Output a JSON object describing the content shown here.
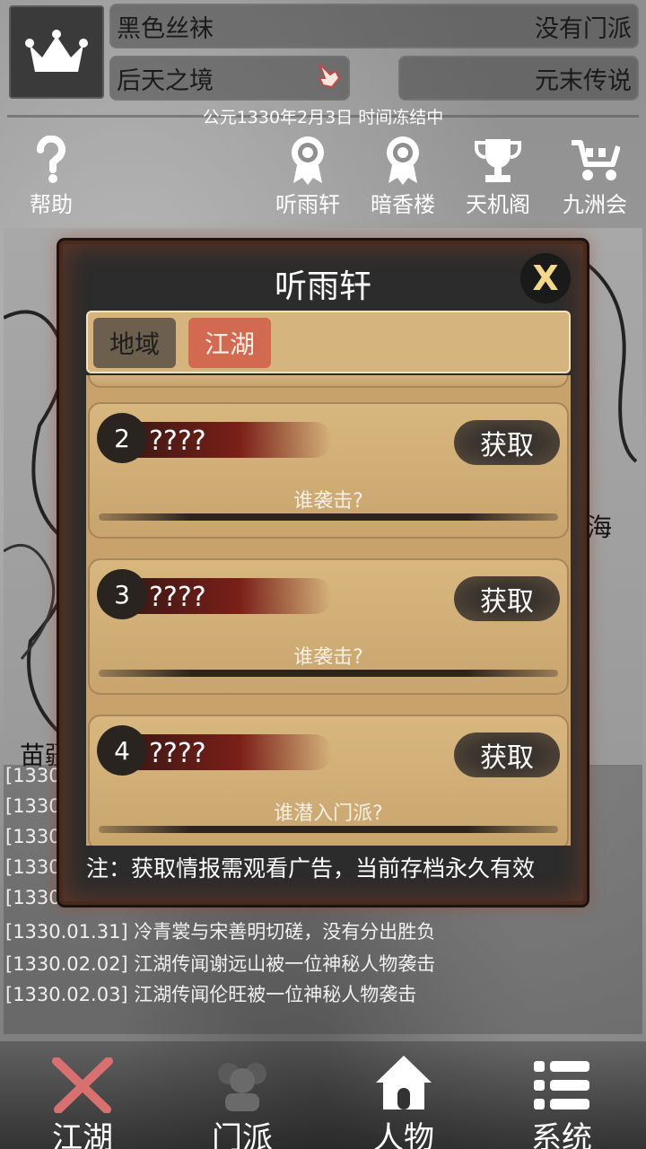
{
  "header": {
    "player_name": "黑色丝袜",
    "sect": "没有门派",
    "realm": "后天之境",
    "title": "元末传说",
    "date_status": "公元1330年2月3日 时间冻结中"
  },
  "top_icons": [
    {
      "label": "帮助",
      "icon": "question-icon"
    },
    {
      "label": "听雨轩",
      "icon": "badge-icon"
    },
    {
      "label": "暗香楼",
      "icon": "badge-icon"
    },
    {
      "label": "天机阁",
      "icon": "trophy-icon"
    },
    {
      "label": "九洲会",
      "icon": "cart-icon"
    }
  ],
  "map_labels": {
    "left": "苗疆",
    "right": "海"
  },
  "log": [
    "[1330.",
    "[1330.",
    "[1330",
    "[1330.",
    "[1330.0",
    "[1330.01.31] 冷青裳与宋善明切磋，没有分出胜负",
    "[1330.02.02] 江湖传闻谢远山被一位神秘人物袭击",
    "[1330.02.03] 江湖传闻伦旺被一位神秘人物袭击"
  ],
  "modal": {
    "title": "听雨轩",
    "close_label": "X",
    "tabs": [
      "地域",
      "江湖"
    ],
    "items": [
      {
        "num": "2",
        "title": "????",
        "button": "获取",
        "question": "谁袭击?"
      },
      {
        "num": "3",
        "title": "????",
        "button": "获取",
        "question": "谁袭击?"
      },
      {
        "num": "4",
        "title": "????",
        "button": "获取",
        "question": "谁潜入门派?"
      }
    ],
    "note": "注：获取情报需观看广告，当前存档永久有效"
  },
  "nav": [
    "江湖",
    "门派",
    "人物",
    "系统"
  ],
  "colors": {
    "tab_active": "#d26a52",
    "tab_inactive": "#6d5f4e",
    "panel": "#c7a26b",
    "close_x": "#f2d98a"
  }
}
